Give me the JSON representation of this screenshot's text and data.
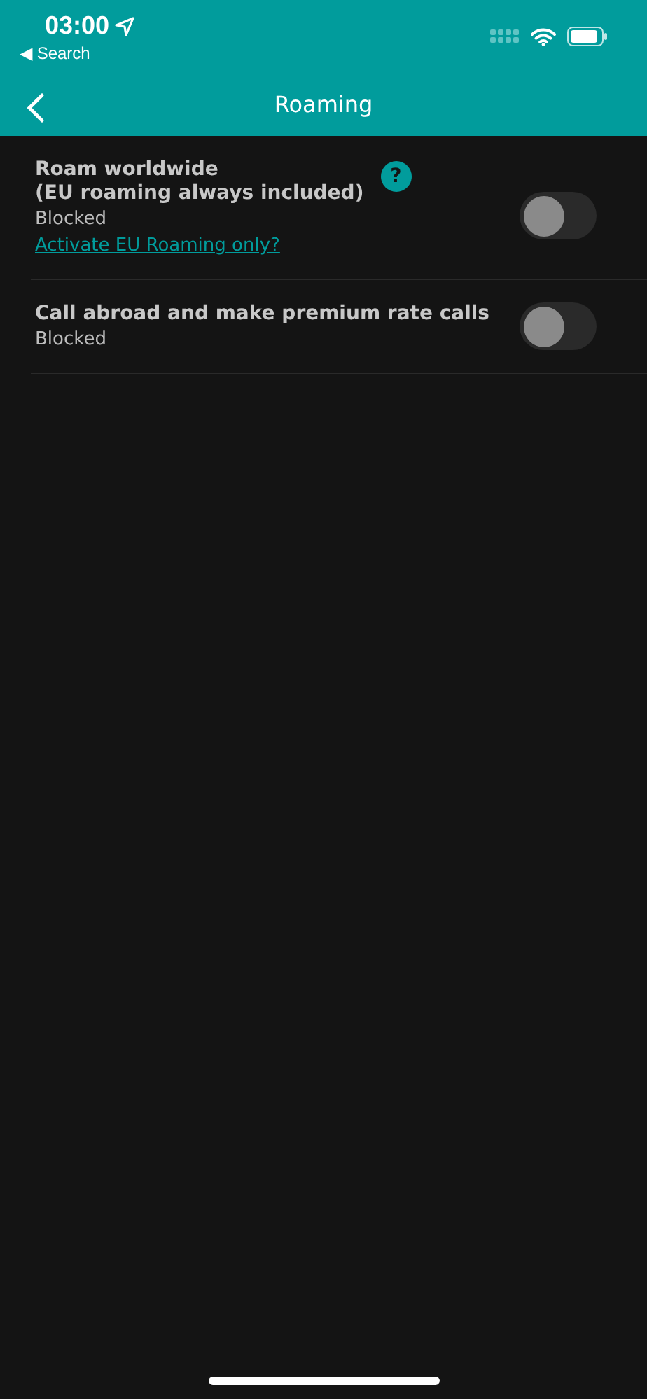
{
  "status_bar": {
    "time": "03:00",
    "back_label": "◀ Search"
  },
  "nav": {
    "title": "Roaming"
  },
  "settings": [
    {
      "title": "Roam worldwide\n(EU roaming always included)",
      "help": "?",
      "status": "Blocked",
      "link": "Activate EU Roaming only?",
      "on": false
    },
    {
      "title": "Call abroad and make premium rate calls",
      "status": "Blocked",
      "on": false
    }
  ]
}
